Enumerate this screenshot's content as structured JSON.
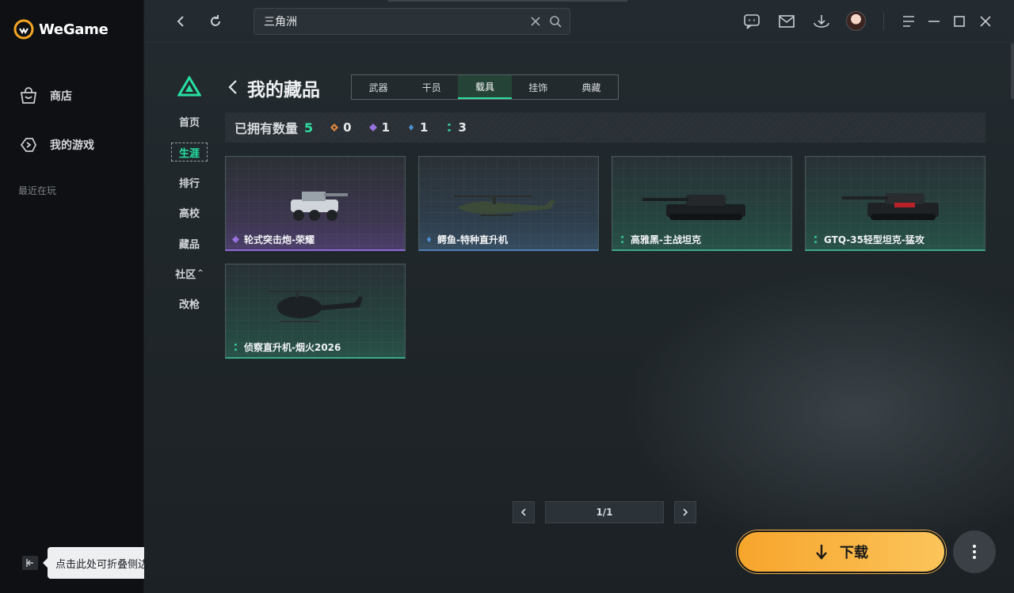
{
  "app": {
    "logo_text": "WeGame",
    "nav": [
      {
        "label": "商店",
        "icon": "store-bag-icon"
      },
      {
        "label": "我的游戏",
        "icon": "gamepad-icon"
      }
    ],
    "recent_label": "最近在玩",
    "collapse_tooltip": "点击此处可折叠侧边栏"
  },
  "topbar": {
    "search_value": "三角洲"
  },
  "game_nav": {
    "items": [
      "首页",
      "生涯",
      "排行",
      "高校",
      "藏品",
      "社区",
      "改枪"
    ],
    "active": "生涯",
    "community_caret": "^"
  },
  "collection": {
    "title": "我的藏品",
    "tabs": [
      "武器",
      "干员",
      "载具",
      "挂饰",
      "典藏"
    ],
    "active_tab": "载具",
    "owned_label": "已拥有数量",
    "owned_count": "5",
    "rarity_counts": [
      {
        "rarity": "orange",
        "color": "#e0853a",
        "count": "0"
      },
      {
        "rarity": "purple",
        "color": "#9a72e0",
        "count": "1"
      },
      {
        "rarity": "blue",
        "color": "#4d8fd0",
        "count": "1"
      },
      {
        "rarity": "green",
        "color": "#33c79a",
        "count": "3"
      }
    ],
    "items": [
      {
        "name": "轮式突击炮-荣耀",
        "rarity": "purple",
        "color": "#9a72e0"
      },
      {
        "name": "鳄鱼-特种直升机",
        "rarity": "blue",
        "color": "#4d8fd0"
      },
      {
        "name": "高雅黑-主战坦克",
        "rarity": "green",
        "color": "#33c79a"
      },
      {
        "name": "GTQ-35轻型坦克-猛攻",
        "rarity": "green",
        "color": "#33c79a"
      },
      {
        "name": "侦察直升机-烟火2026",
        "rarity": "green",
        "color": "#33c79a"
      }
    ]
  },
  "pagination": {
    "indicator": "1/1"
  },
  "actions": {
    "download_label": "下载"
  },
  "colors": {
    "accent_green": "#2fe0a0",
    "download": "#f7a52c"
  }
}
